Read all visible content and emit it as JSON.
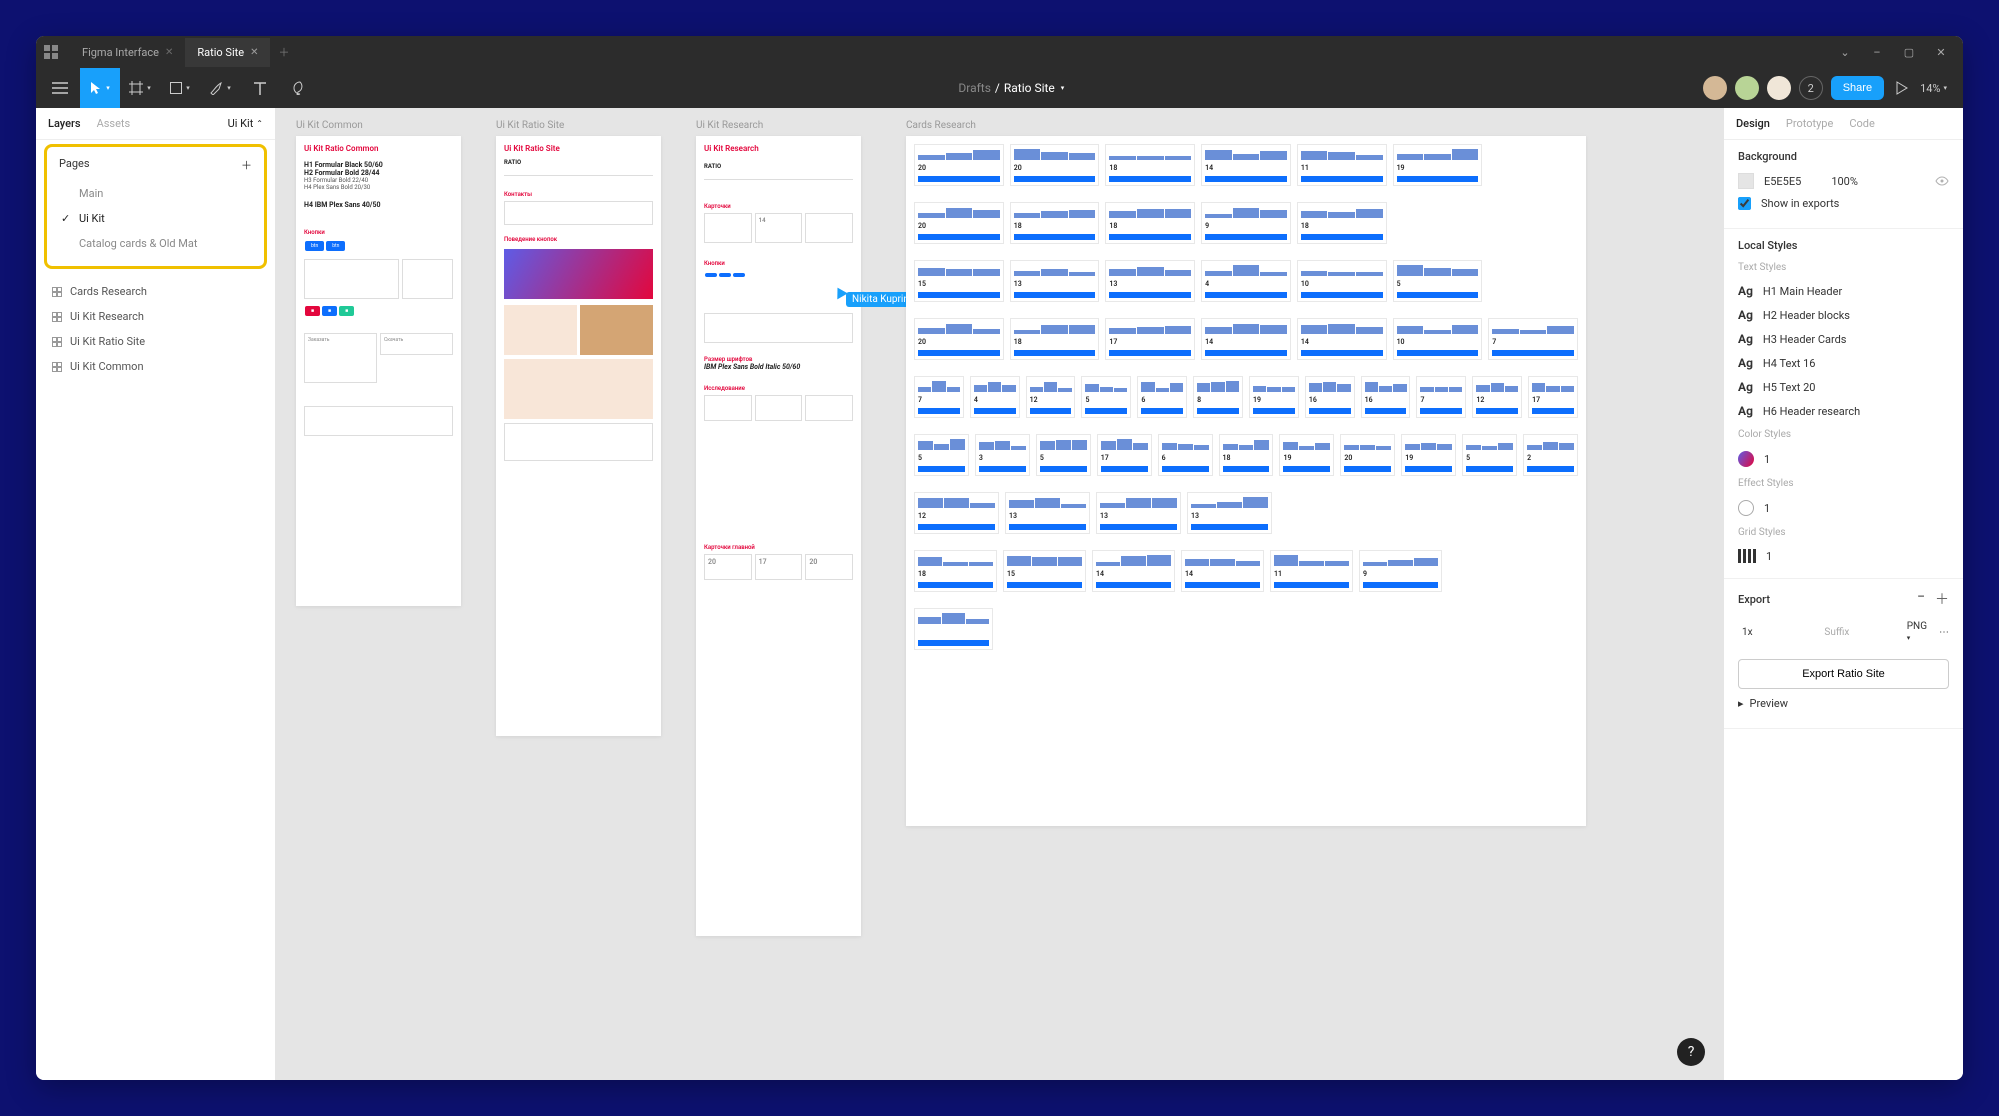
{
  "titlebar": {
    "tab1": "Figma Interface",
    "tab2": "Ratio Site"
  },
  "toolbar": {
    "breadcrumb_parent": "Drafts",
    "breadcrumb_sep": "/",
    "breadcrumb_current": "Ratio Site",
    "share": "Share",
    "zoom": "14%",
    "collaborator_count": "2"
  },
  "left": {
    "tab_layers": "Layers",
    "tab_assets": "Assets",
    "page_select": "Ui Kit",
    "pages_label": "Pages",
    "pages": [
      "Main",
      "Ui Kit",
      "Catalog cards & Old Mat"
    ],
    "frames": [
      "Cards Research",
      "Ui Kit Research",
      "Ui Kit Ratio Site",
      "Ui Kit Common"
    ]
  },
  "canvas": {
    "frame_labels": [
      "Ui Kit Common",
      "Ui Kit Ratio Site",
      "Ui Kit Research",
      "Cards Research"
    ],
    "f1_title": "Ui Kit Ratio Common",
    "f1_h1": "H1 Formular Black 50/60",
    "f1_h2": "H2 Formular Bold 28/44",
    "f1_h3": "H3 Formular Bold 22/40",
    "f1_h4": "H4 Plex Sans Bold 20/30",
    "f1_h5": "H4 IBM Plex Sans 40/50",
    "f2_title": "Ui Kit Ratio Site",
    "f3_title": "Ui Kit Research",
    "f3_font": "IBM Plex Sans Bold Italic 50/60",
    "cursor_name": "Nikita Kuprin",
    "card_nums_row1": [
      "20",
      "20",
      "18",
      "14",
      "11",
      "19"
    ],
    "card_nums_row2": [
      "20",
      "18",
      "18",
      "9",
      "18"
    ],
    "card_nums_row3": [
      "15",
      "13",
      "13",
      "4",
      "10",
      "5"
    ],
    "card_nums_row4": [
      "20",
      "18",
      "17",
      "14",
      "14",
      "10",
      "7"
    ],
    "card_nums_row5": [
      "7",
      "4",
      "12",
      "5",
      "6",
      "8",
      "19",
      "16",
      "16",
      "7",
      "12",
      "17"
    ],
    "card_nums_row6": [
      "5",
      "3",
      "5",
      "17",
      "6",
      "18",
      "19",
      "20",
      "19",
      "5",
      "2"
    ],
    "card_nums_row7": [
      "12",
      "13",
      "13",
      "13"
    ],
    "card_nums_row8": [
      "18",
      "15",
      "14",
      "14",
      "11",
      "9"
    ],
    "f3_bottom": [
      "20",
      "17",
      "20"
    ]
  },
  "right": {
    "tab_design": "Design",
    "tab_prototype": "Prototype",
    "tab_code": "Code",
    "bg_title": "Background",
    "bg_color": "E5E5E5",
    "bg_opacity": "100%",
    "bg_show": "Show in exports",
    "local_styles": "Local Styles",
    "text_styles": "Text Styles",
    "styles": [
      "H1 Main Header",
      "H2 Header blocks",
      "H3 Header Cards",
      "H4 Text 16",
      "H5 Text 20",
      "H6 Header research"
    ],
    "color_styles": "Color Styles",
    "color_name": "1",
    "effect_styles": "Effect Styles",
    "effect_name": "1",
    "grid_styles": "Grid Styles",
    "grid_name": "1",
    "export_title": "Export",
    "export_scale": "1x",
    "export_suffix": "Suffix",
    "export_format": "PNG",
    "export_btn": "Export Ratio Site",
    "preview": "Preview"
  }
}
